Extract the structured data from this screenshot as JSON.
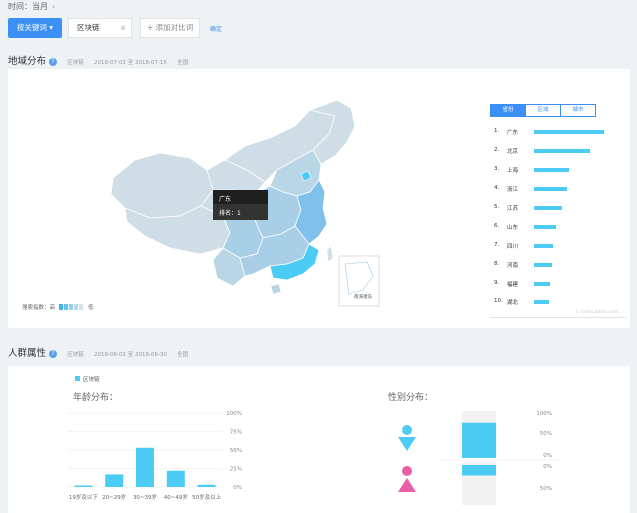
{
  "time_bar": {
    "label": "时间：当月"
  },
  "toolbar": {
    "keyword_button": "按关键词",
    "keyword_value": "区块链",
    "add_compare": "+ 添加对比词",
    "confirm": "确定"
  },
  "region": {
    "title": "地域分布",
    "keyword": "区块链",
    "date_range": "2018-07-01 至 2018-07-15",
    "scope": "全国",
    "tabs": [
      {
        "label": "省份",
        "active": true
      },
      {
        "label": "区域",
        "active": false
      },
      {
        "label": "城市",
        "active": false
      }
    ],
    "ranking": [
      {
        "rank": "1.",
        "name": "广东",
        "value": 100
      },
      {
        "rank": "2.",
        "name": "北京",
        "value": 80
      },
      {
        "rank": "3.",
        "name": "上海",
        "value": 50
      },
      {
        "rank": "4.",
        "name": "浙江",
        "value": 47
      },
      {
        "rank": "5.",
        "name": "江苏",
        "value": 40
      },
      {
        "rank": "6.",
        "name": "山东",
        "value": 31
      },
      {
        "rank": "7.",
        "name": "四川",
        "value": 27
      },
      {
        "rank": "8.",
        "name": "河南",
        "value": 26
      },
      {
        "rank": "9.",
        "name": "福建",
        "value": 23
      },
      {
        "rank": "10.",
        "name": "湖北",
        "value": 22
      }
    ],
    "tooltip": {
      "province": "广东",
      "rank_label": "排名：",
      "rank_value": "1"
    },
    "legend": {
      "label": "搜索指数：",
      "high": "高",
      "low": "低"
    },
    "inset_label": "南海诸岛",
    "watermark": "© index.baidu.com",
    "colors": {
      "highlight": "#4ccbf5",
      "map_base": "#cfdde6",
      "map_mid": "#a8cfe6",
      "map_dark": "#7fc1ea"
    }
  },
  "crowd": {
    "title": "人群属性",
    "keyword": "区块链",
    "date_range": "2018-06-01 至 2018-06-30",
    "scope": "全国",
    "legend_label": "区块链",
    "age": {
      "title": "年龄分布：",
      "y_ticks": [
        "100%",
        "75%",
        "50%",
        "25%",
        "0%"
      ]
    },
    "gender": {
      "title": "性别分布：",
      "male_ticks": [
        "100%",
        "50%",
        "0%"
      ],
      "female_ticks": [
        "0%",
        "50%"
      ],
      "male_pct": 75,
      "female_pct": 25
    }
  },
  "chart_data": {
    "type": "bar",
    "title": "年龄分布：",
    "categories": [
      "19岁及以下",
      "20~29岁",
      "30~39岁",
      "40~49岁",
      "50岁及以上"
    ],
    "series": [
      {
        "name": "区块链",
        "values": [
          2,
          17,
          53,
          22,
          3
        ]
      }
    ],
    "ylim": [
      0,
      100
    ],
    "yunit": "%",
    "color": "#4ccbf5"
  }
}
